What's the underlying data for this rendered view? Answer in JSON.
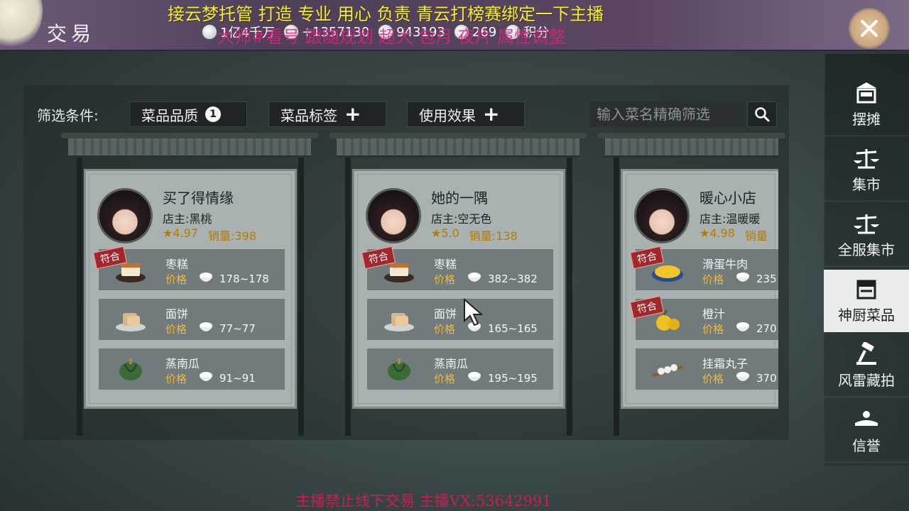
{
  "header": {
    "title": "交易",
    "currencies": [
      {
        "icon": "coin-icon",
        "value": "1亿4千万"
      },
      {
        "icon": "silver-icon",
        "value": "+1357130"
      },
      {
        "icon": "ingot-icon",
        "value": "943193"
      },
      {
        "icon": "jade-icon",
        "value": "269"
      },
      {
        "icon": "points-icon",
        "value": "积分"
      }
    ],
    "close_icon": "close-icon"
  },
  "stream_overlay": {
    "top_line": "接云梦托管 打造 专业 用心 负责   青云打榜赛绑定一下主播",
    "second_line": "大师#看号 跟随规划 超大 包月 夜片 属性调整",
    "bottom_line": "主播禁止线下交易     主播VX:53642991"
  },
  "filters": {
    "label": "筛选条件:",
    "quality": {
      "label": "菜品品质",
      "count": "1"
    },
    "tags": {
      "label": "菜品标签"
    },
    "effect": {
      "label": "使用效果"
    },
    "search_placeholder": "输入菜名精确筛选"
  },
  "shops": [
    {
      "name": "买了得情缘",
      "owner": "店主:黑桃",
      "rating": "4.97",
      "sales": "销量:398",
      "items": [
        {
          "name": "枣糕",
          "price_label": "价格",
          "price": "178~178",
          "match": "符合",
          "icon": "date-cake-icon"
        },
        {
          "name": "面饼",
          "price_label": "价格",
          "price": "77~77",
          "match": "",
          "icon": "flatbread-icon"
        },
        {
          "name": "蒸南瓜",
          "price_label": "价格",
          "price": "91~91",
          "match": "",
          "icon": "pumpkin-icon"
        }
      ]
    },
    {
      "name": "她的一隅",
      "owner": "店主:空无色",
      "rating": "5.0",
      "sales": "销量:138",
      "items": [
        {
          "name": "枣糕",
          "price_label": "价格",
          "price": "382~382",
          "match": "符合",
          "icon": "date-cake-icon"
        },
        {
          "name": "面饼",
          "price_label": "价格",
          "price": "165~165",
          "match": "",
          "icon": "flatbread-icon"
        },
        {
          "name": "蒸南瓜",
          "price_label": "价格",
          "price": "195~195",
          "match": "",
          "icon": "pumpkin-icon"
        }
      ]
    },
    {
      "name": "暖心小店",
      "owner": "店主:温暖暖",
      "rating": "4.98",
      "sales": "销量",
      "items": [
        {
          "name": "滑蛋牛肉",
          "price_label": "价格",
          "price": "235",
          "match": "符合",
          "icon": "egg-beef-icon"
        },
        {
          "name": "橙汁",
          "price_label": "价格",
          "price": "270",
          "match": "符合",
          "icon": "orange-juice-icon"
        },
        {
          "name": "挂霜丸子",
          "price_label": "价格",
          "price": "370",
          "match": "",
          "icon": "meatball-icon"
        }
      ]
    }
  ],
  "sidebar": [
    {
      "label": "摆摊",
      "icon": "stall-icon",
      "active": false
    },
    {
      "label": "集市",
      "icon": "scale-icon",
      "active": false
    },
    {
      "label": "全服集市",
      "icon": "scale-icon",
      "active": false
    },
    {
      "label": "神厨菜品",
      "icon": "kitchen-icon",
      "active": true
    },
    {
      "label": "风雷藏拍",
      "icon": "gavel-icon",
      "active": false
    },
    {
      "label": "信誉",
      "icon": "reputation-icon",
      "active": false
    }
  ],
  "colors": {
    "header_bg": "#5a4662",
    "card_bg": "#a9b2b1",
    "item_bg": "#717b7b",
    "price_label": "#f0b83a",
    "rating": "#b57b00",
    "match_tag": "#a2262c",
    "overlay_yellow": "#f4ec3c",
    "overlay_pink": "#d8247c"
  }
}
